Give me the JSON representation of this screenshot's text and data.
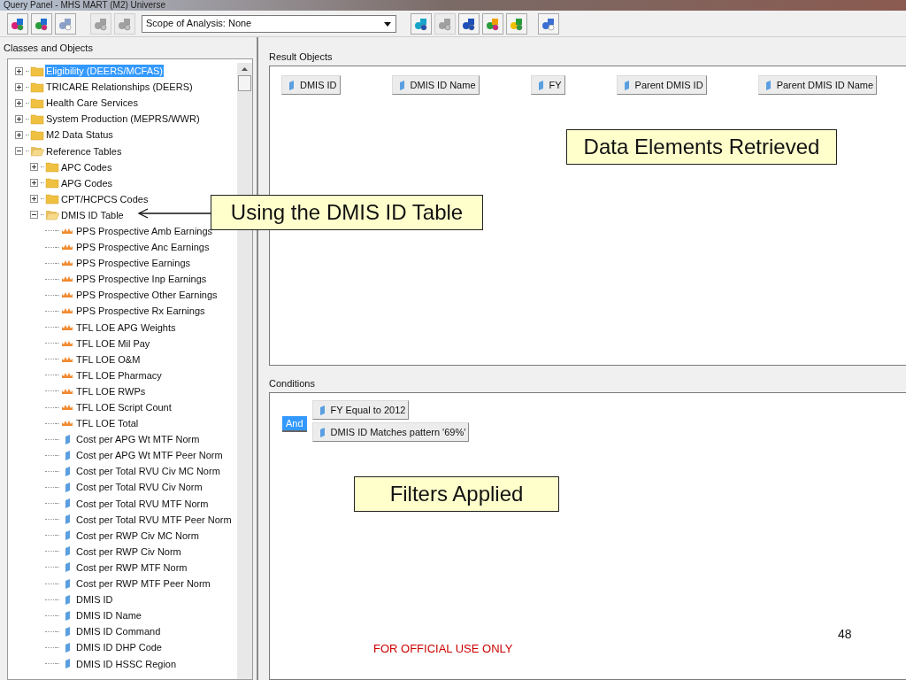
{
  "window": {
    "title": "Query Panel - MHS MART (M2) Universe"
  },
  "toolbar": {
    "left_buttons": [
      {
        "disabled": false
      },
      {
        "disabled": false
      },
      {
        "disabled": false
      },
      {
        "disabled": true
      },
      {
        "disabled": true
      }
    ],
    "scope": {
      "value": "Scope of Analysis: None"
    },
    "right_buttons": [
      {
        "disabled": false
      },
      {
        "disabled": true
      },
      {
        "disabled": false
      },
      {
        "disabled": false
      },
      {
        "disabled": false
      },
      {
        "disabled": false
      }
    ]
  },
  "classes_panel": {
    "label": "Classes and Objects",
    "tree": [
      {
        "label": "Eligibility (DEERS/MCFAS)",
        "kind": "folder",
        "expanded": false,
        "selected": true
      },
      {
        "label": "TRICARE Relationships (DEERS)",
        "kind": "folder",
        "expanded": false,
        "selected": false
      },
      {
        "label": "Health Care Services",
        "kind": "folder",
        "expanded": false,
        "selected": false
      },
      {
        "label": "System Production (MEPRS/WWR)",
        "kind": "folder",
        "expanded": false,
        "selected": false
      },
      {
        "label": "M2 Data Status",
        "kind": "folder",
        "expanded": false,
        "selected": false
      },
      {
        "label": "Reference Tables",
        "kind": "folder",
        "expanded": true,
        "selected": false,
        "children": [
          {
            "label": "APC Codes",
            "kind": "folder",
            "expanded": false,
            "selected": false
          },
          {
            "label": "APG Codes",
            "kind": "folder",
            "expanded": false,
            "selected": false
          },
          {
            "label": "CPT/HCPCS Codes",
            "kind": "folder",
            "expanded": false,
            "selected": false
          },
          {
            "label": "DMIS ID Table",
            "kind": "folder",
            "expanded": true,
            "selected": false,
            "children": [
              {
                "label": "PPS Prospective Amb Earnings",
                "kind": "measure",
                "selected": false
              },
              {
                "label": "PPS Prospective Anc Earnings",
                "kind": "measure",
                "selected": false
              },
              {
                "label": "PPS Prospective Earnings",
                "kind": "measure",
                "selected": false
              },
              {
                "label": "PPS Prospective Inp Earnings",
                "kind": "measure",
                "selected": false
              },
              {
                "label": "PPS Prospective Other Earnings",
                "kind": "measure",
                "selected": false
              },
              {
                "label": "PPS Prospective Rx Earnings",
                "kind": "measure",
                "selected": false
              },
              {
                "label": "TFL LOE APG Weights",
                "kind": "measure",
                "selected": false
              },
              {
                "label": "TFL LOE Mil Pay",
                "kind": "measure",
                "selected": false
              },
              {
                "label": "TFL LOE O&M",
                "kind": "measure",
                "selected": false
              },
              {
                "label": "TFL LOE Pharmacy",
                "kind": "measure",
                "selected": false
              },
              {
                "label": "TFL LOE RWPs",
                "kind": "measure",
                "selected": false
              },
              {
                "label": "TFL LOE Script Count",
                "kind": "measure",
                "selected": false
              },
              {
                "label": "TFL LOE Total",
                "kind": "measure",
                "selected": false
              },
              {
                "label": "Cost per APG Wt MTF Norm",
                "kind": "dimension",
                "selected": false
              },
              {
                "label": "Cost per APG Wt MTF Peer Norm",
                "kind": "dimension",
                "selected": false
              },
              {
                "label": "Cost per Total RVU Civ MC Norm",
                "kind": "dimension",
                "selected": false
              },
              {
                "label": "Cost per Total RVU Civ Norm",
                "kind": "dimension",
                "selected": false
              },
              {
                "label": "Cost per Total RVU MTF Norm",
                "kind": "dimension",
                "selected": false
              },
              {
                "label": "Cost per Total RVU MTF Peer Norm",
                "kind": "dimension",
                "selected": false
              },
              {
                "label": "Cost per RWP Civ MC Norm",
                "kind": "dimension",
                "selected": false
              },
              {
                "label": "Cost per RWP Civ Norm",
                "kind": "dimension",
                "selected": false
              },
              {
                "label": "Cost per RWP MTF Norm",
                "kind": "dimension",
                "selected": false
              },
              {
                "label": "Cost per RWP MTF Peer Norm",
                "kind": "dimension",
                "selected": false
              },
              {
                "label": "DMIS ID",
                "kind": "dimension",
                "selected": false
              },
              {
                "label": "DMIS ID Name",
                "kind": "dimension",
                "selected": false
              },
              {
                "label": "DMIS ID Command",
                "kind": "dimension",
                "selected": false
              },
              {
                "label": "DMIS ID DHP Code",
                "kind": "dimension",
                "selected": false
              },
              {
                "label": "DMIS ID HSSC Region",
                "kind": "dimension",
                "selected": false
              }
            ]
          }
        ]
      }
    ]
  },
  "result_objects": {
    "label": "Result Objects",
    "items": [
      "DMIS ID",
      "DMIS ID Name",
      "FY",
      "Parent DMIS ID",
      "Parent DMIS ID Name"
    ]
  },
  "conditions": {
    "label": "Conditions",
    "operator": {
      "label": "And",
      "selected": true
    },
    "items": [
      "FY Equal to 2012",
      "DMIS ID Matches pattern '69%'"
    ]
  },
  "callouts": [
    "Data Elements Retrieved",
    "Using the DMIS ID Table",
    "Filters Applied"
  ],
  "slide": {
    "page_number": "48",
    "footer": "FOR OFFICIAL USE ONLY"
  }
}
